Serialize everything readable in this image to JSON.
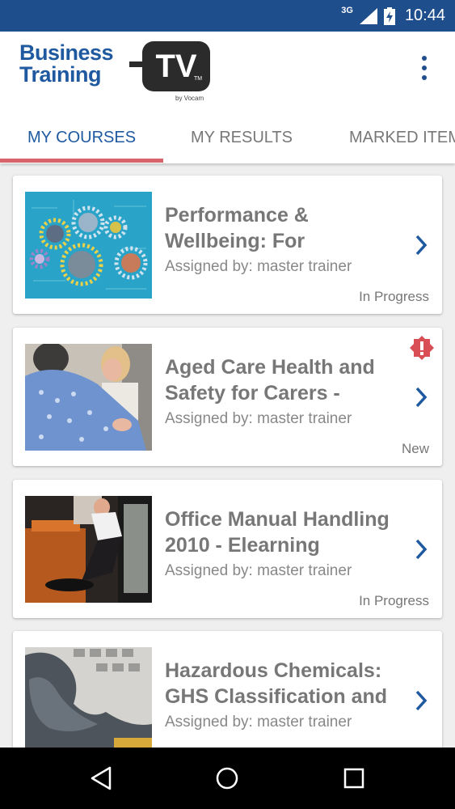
{
  "status_bar": {
    "network": "3G",
    "time": "10:44",
    "icons": [
      "signal-icon",
      "battery-charging-icon"
    ]
  },
  "app_bar": {
    "logo": {
      "line1": "Business",
      "line2": "Training",
      "tv": "TV",
      "tm": "TM",
      "byline": "by Vocam"
    },
    "menu_icon": "overflow-menu-icon"
  },
  "tabs": [
    {
      "label": "MY COURSES",
      "active": true
    },
    {
      "label": "MY RESULTS",
      "active": false
    },
    {
      "label": "MARKED ITEMS",
      "active": false
    }
  ],
  "courses": [
    {
      "title": "Performance & Wellbeing: For",
      "assigned": "Assigned by: master trainer",
      "status": "In Progress",
      "alert": false,
      "thumbnail": "gears-illustration"
    },
    {
      "title": "Aged Care Health and Safety for Carers -",
      "assigned": "Assigned by: master trainer",
      "status": "New",
      "alert": true,
      "thumbnail": "carer-hug-photo"
    },
    {
      "title": "Office Manual Handling 2010 - Elearning",
      "assigned": "Assigned by: master trainer",
      "status": "In Progress",
      "alert": false,
      "thumbnail": "office-fall-photo"
    },
    {
      "title": "Hazardous Chemicals: GHS Classification and",
      "assigned": "Assigned by: master trainer",
      "status": "",
      "alert": false,
      "thumbnail": "chemical-smoke-photo"
    }
  ],
  "colors": {
    "primary": "#1f4e8c",
    "accent": "#d9636a",
    "alert": "#d94e55",
    "text_muted": "#777777"
  },
  "nav_bar": {
    "icons": [
      "back-icon",
      "home-icon",
      "recents-icon"
    ]
  }
}
